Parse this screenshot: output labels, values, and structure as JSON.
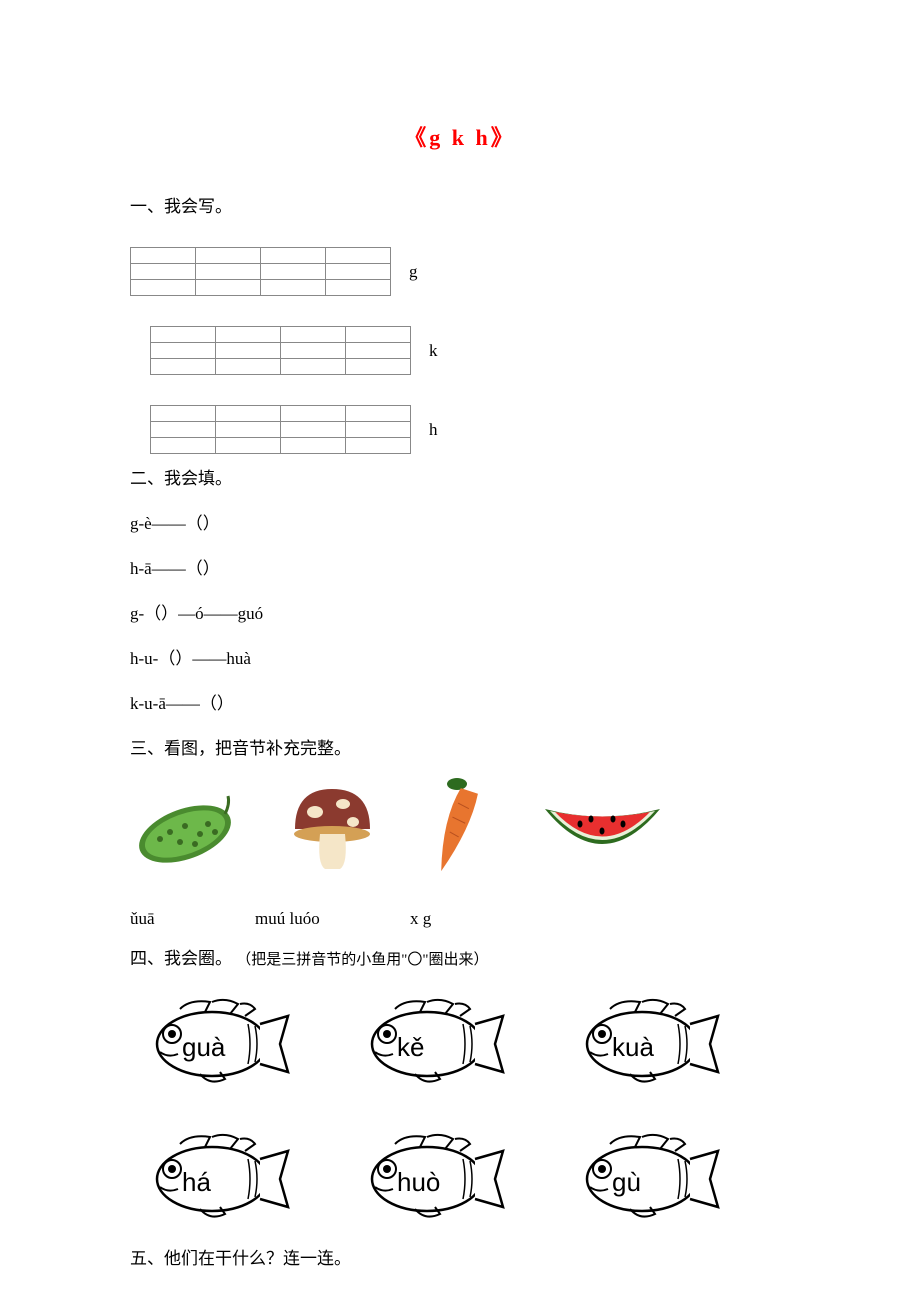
{
  "title": "《g k h》",
  "section1": {
    "heading": "一、我会写。",
    "rows": [
      {
        "label": "g"
      },
      {
        "label": "k"
      },
      {
        "label": "h"
      }
    ]
  },
  "section2": {
    "heading": "二、我会填。",
    "lines": [
      "g-è——（）",
      "h-ā——（）",
      "g-（）—ó——guó",
      "h-u-（）——huà",
      "k-u-ā——（）"
    ]
  },
  "section3": {
    "heading": "三、看图，把音节补充完整。",
    "images": [
      {
        "name": "bitter-gourd-icon"
      },
      {
        "name": "mushroom-icon"
      },
      {
        "name": "carrot-icon"
      },
      {
        "name": "watermelon-icon"
      }
    ],
    "answers_part1": "ǔuā",
    "answers_part2": "muú luóo",
    "answers_part3": "x g"
  },
  "section4": {
    "heading": "四、我会圈。",
    "subheading": "（把是三拼音节的小鱼用\"〇\"圈出来）",
    "fish": [
      {
        "text": "guà"
      },
      {
        "text": "kě"
      },
      {
        "text": "kuà"
      },
      {
        "text": "há"
      },
      {
        "text": "huò"
      },
      {
        "text": "gù"
      }
    ]
  },
  "section5": {
    "heading": "五、他们在干什么？连一连。"
  }
}
